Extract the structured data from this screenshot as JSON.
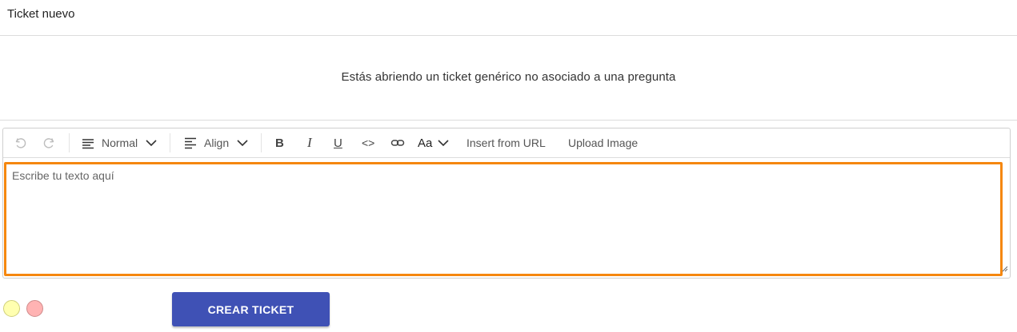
{
  "header": {
    "title": "Ticket nuevo"
  },
  "info": {
    "message": "Estás abriendo un ticket genérico no asociado a una pregunta"
  },
  "toolbar": {
    "undo_icon": "undo-icon",
    "redo_icon": "redo-icon",
    "block_type_label": "Normal",
    "align_label": "Align",
    "bold_label": "B",
    "italic_label": "I",
    "underline_label": "U",
    "code_label": "<>",
    "font_size_label": "Aa",
    "insert_url_label": "Insert from URL",
    "upload_image_label": "Upload Image"
  },
  "editor": {
    "placeholder": "Escribe tu texto aquí",
    "focus_color": "#f5870f"
  },
  "status_dots": [
    {
      "name": "yellow",
      "color": "#ffffb0"
    },
    {
      "name": "red",
      "color": "#ffb3b3"
    }
  ],
  "actions": {
    "create_label": "CREAR TICKET",
    "create_color": "#3f51b5"
  }
}
